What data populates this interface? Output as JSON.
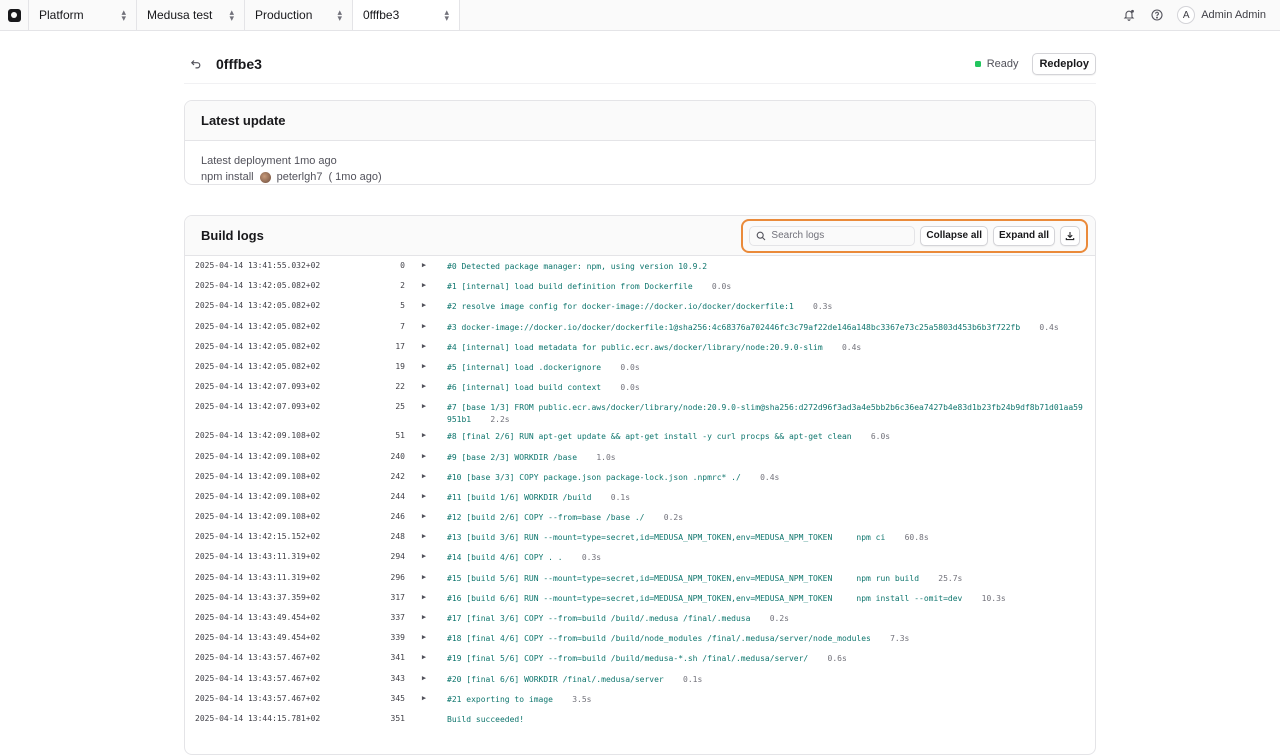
{
  "nav": {
    "crumbs": [
      {
        "label": "Platform"
      },
      {
        "label": "Medusa test"
      },
      {
        "label": "Production"
      },
      {
        "label": "0fffbe3"
      }
    ],
    "user_initial": "A",
    "user_name": "Admin Admin"
  },
  "header": {
    "title": "0fffbe3",
    "status": "Ready",
    "status_color": "#22c55e",
    "redeploy_label": "Redeploy"
  },
  "latest_update": {
    "title": "Latest update",
    "line1": "Latest deployment 1mo ago",
    "command": "npm install",
    "author": "peterlgh7",
    "author_suffix": "( 1mo ago)"
  },
  "build_logs": {
    "title": "Build logs",
    "search_placeholder": "Search logs",
    "collapse_label": "Collapse all",
    "expand_label": "Expand all",
    "highlight_color": "#ea8a3a",
    "rows": [
      {
        "ts": "2025-04-14 13:41:55.032+02",
        "n": "0",
        "msg": "#0 Detected package manager: npm, using version 10.9.2",
        "dur": ""
      },
      {
        "ts": "2025-04-14 13:42:05.082+02",
        "n": "2",
        "msg": "#1 [internal] load build definition from Dockerfile",
        "dur": "0.0s"
      },
      {
        "ts": "2025-04-14 13:42:05.082+02",
        "n": "5",
        "msg": "#2 resolve image config for docker-image://docker.io/docker/dockerfile:1",
        "dur": "0.3s"
      },
      {
        "ts": "2025-04-14 13:42:05.082+02",
        "n": "7",
        "msg": "#3 docker-image://docker.io/docker/dockerfile:1@sha256:4c68376a702446fc3c79af22de146a148bc3367e73c25a5803d453b6b3f722fb",
        "dur": "0.4s"
      },
      {
        "ts": "2025-04-14 13:42:05.082+02",
        "n": "17",
        "msg": "#4 [internal] load metadata for public.ecr.aws/docker/library/node:20.9.0-slim",
        "dur": "0.4s"
      },
      {
        "ts": "2025-04-14 13:42:05.082+02",
        "n": "19",
        "msg": "#5 [internal] load .dockerignore",
        "dur": "0.0s"
      },
      {
        "ts": "2025-04-14 13:42:07.093+02",
        "n": "22",
        "msg": "#6 [internal] load build context",
        "dur": "0.0s"
      },
      {
        "ts": "2025-04-14 13:42:07.093+02",
        "n": "25",
        "msg": "#7 [base 1/3] FROM public.ecr.aws/docker/library/node:20.9.0-slim@sha256:d272d96f3ad3a4e5bb2b6c36ea7427b4e83d1b23fb24b9df8b71d01aa59951b1",
        "dur": "2.2s"
      },
      {
        "ts": "2025-04-14 13:42:09.108+02",
        "n": "51",
        "msg": "#8 [final 2/6] RUN apt-get update && apt-get install -y curl procps && apt-get clean",
        "dur": "6.0s"
      },
      {
        "ts": "2025-04-14 13:42:09.108+02",
        "n": "240",
        "msg": "#9 [base 2/3] WORKDIR /base",
        "dur": "1.0s"
      },
      {
        "ts": "2025-04-14 13:42:09.108+02",
        "n": "242",
        "msg": "#10 [base 3/3] COPY package.json package-lock.json .npmrc* ./",
        "dur": "0.4s"
      },
      {
        "ts": "2025-04-14 13:42:09.108+02",
        "n": "244",
        "msg": "#11 [build 1/6] WORKDIR /build",
        "dur": "0.1s"
      },
      {
        "ts": "2025-04-14 13:42:09.108+02",
        "n": "246",
        "msg": "#12 [build 2/6] COPY --from=base /base ./",
        "dur": "0.2s"
      },
      {
        "ts": "2025-04-14 13:42:15.152+02",
        "n": "248",
        "msg": "#13 [build 3/6] RUN --mount=type=secret,id=MEDUSA_NPM_TOKEN,env=MEDUSA_NPM_TOKEN     npm ci",
        "dur": "60.8s"
      },
      {
        "ts": "2025-04-14 13:43:11.319+02",
        "n": "294",
        "msg": "#14 [build 4/6] COPY . .",
        "dur": "0.3s"
      },
      {
        "ts": "2025-04-14 13:43:11.319+02",
        "n": "296",
        "msg": "#15 [build 5/6] RUN --mount=type=secret,id=MEDUSA_NPM_TOKEN,env=MEDUSA_NPM_TOKEN     npm run build",
        "dur": "25.7s"
      },
      {
        "ts": "2025-04-14 13:43:37.359+02",
        "n": "317",
        "msg": "#16 [build 6/6] RUN --mount=type=secret,id=MEDUSA_NPM_TOKEN,env=MEDUSA_NPM_TOKEN     npm install --omit=dev",
        "dur": "10.3s"
      },
      {
        "ts": "2025-04-14 13:43:49.454+02",
        "n": "337",
        "msg": "#17 [final 3/6] COPY --from=build /build/.medusa /final/.medusa",
        "dur": "0.2s"
      },
      {
        "ts": "2025-04-14 13:43:49.454+02",
        "n": "339",
        "msg": "#18 [final 4/6] COPY --from=build /build/node_modules /final/.medusa/server/node_modules",
        "dur": "7.3s"
      },
      {
        "ts": "2025-04-14 13:43:57.467+02",
        "n": "341",
        "msg": "#19 [final 5/6] COPY --from=build /build/medusa-*.sh /final/.medusa/server/",
        "dur": "0.6s"
      },
      {
        "ts": "2025-04-14 13:43:57.467+02",
        "n": "343",
        "msg": "#20 [final 6/6] WORKDIR /final/.medusa/server",
        "dur": "0.1s"
      },
      {
        "ts": "2025-04-14 13:43:57.467+02",
        "n": "345",
        "msg": "#21 exporting to image",
        "dur": "3.5s"
      },
      {
        "ts": "2025-04-14 13:44:15.781+02",
        "n": "351",
        "msg": "Build succeeded!",
        "dur": ""
      }
    ]
  }
}
